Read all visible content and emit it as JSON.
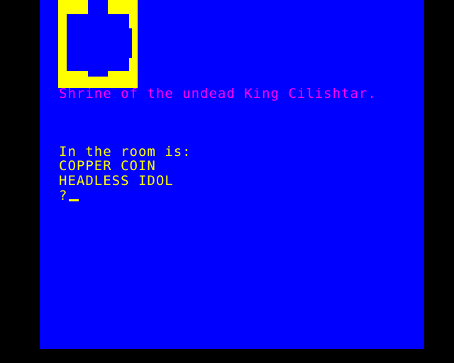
{
  "colors": {
    "border": "#000000",
    "background": "#0000FF",
    "title": "#FF00FF",
    "text": "#FFFF00",
    "map": "#FFFF00"
  },
  "room": {
    "title": "Shrine of the undead King Cilishtar.",
    "contents_label": "In the room is:",
    "items": [
      "COPPER COIN",
      "HEADLESS IDOL"
    ]
  },
  "input": {
    "prompt": "?",
    "value": ""
  }
}
